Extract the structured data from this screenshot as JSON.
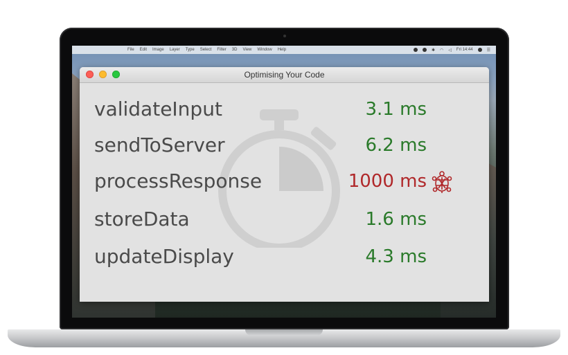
{
  "window": {
    "title": "Optimising Your Code"
  },
  "menubar": {
    "items": [
      "File",
      "Edit",
      "Image",
      "Layer",
      "Type",
      "Select",
      "Filter",
      "3D",
      "View",
      "Window",
      "Help"
    ],
    "clock": "Fri 14:44"
  },
  "timings": [
    {
      "name": "validateInput",
      "time": "3.1 ms",
      "status": "ok"
    },
    {
      "name": "sendToServer",
      "time": "6.2 ms",
      "status": "ok"
    },
    {
      "name": "processResponse",
      "time": "1000 ms",
      "status": "slow"
    },
    {
      "name": "storeData",
      "time": "1.6 ms",
      "status": "ok"
    },
    {
      "name": "updateDisplay",
      "time": "4.3 ms",
      "status": "ok"
    }
  ],
  "icons": {
    "background": "stopwatch-icon",
    "slow_marker": "turtle-icon"
  },
  "colors": {
    "ok": "#2a7a2a",
    "slow": "#b0282a",
    "text": "#4a4a4a",
    "window_bg": "#e2e2e2"
  }
}
